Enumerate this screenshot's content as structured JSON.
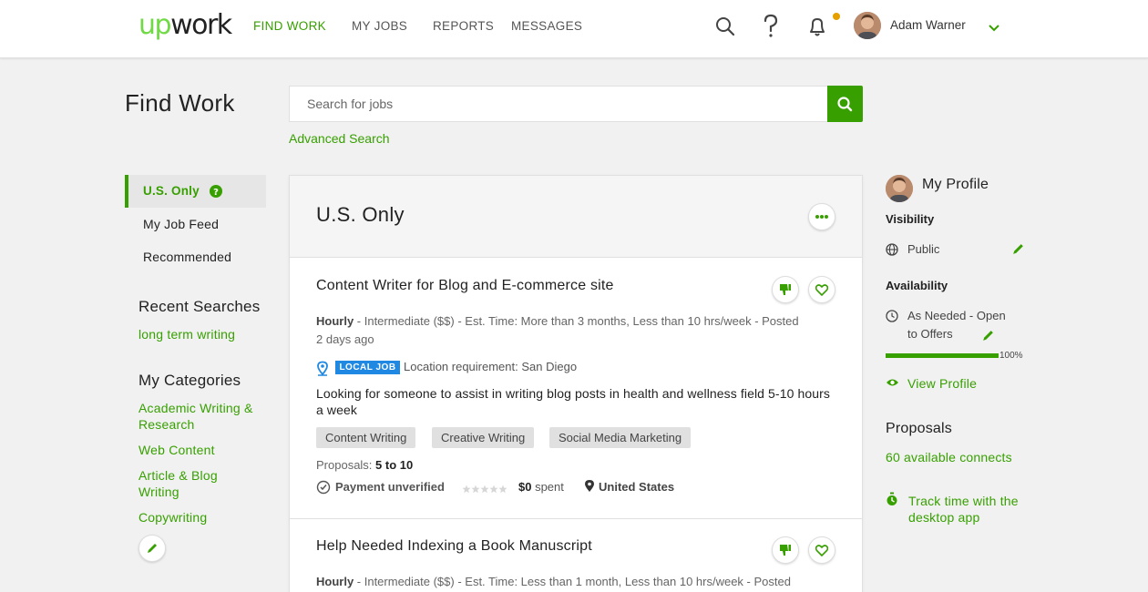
{
  "header": {
    "logo_up": "up",
    "logo_work": "work",
    "nav": [
      "FIND WORK",
      "MY JOBS",
      "REPORTS",
      "MESSAGES"
    ],
    "user_name": "Adam Warner",
    "notification_dot_color": "#e5a000"
  },
  "page": {
    "title": "Find Work",
    "search_placeholder": "Search for jobs",
    "advanced_search": "Advanced Search"
  },
  "sidebar": {
    "feeds": [
      "U.S. Only",
      "My Job Feed",
      "Recommended"
    ],
    "recent_searches_heading": "Recent Searches",
    "recent_searches": [
      "long term writing"
    ],
    "categories_heading": "My Categories",
    "categories": [
      "Academic Writing & Research",
      "Web Content",
      "Article & Blog Writing",
      "Copywriting"
    ]
  },
  "feed": {
    "title": "U.S. Only",
    "jobs": [
      {
        "title": "Content Writer for Blog and E-commerce site",
        "type": "Hourly",
        "meta": " - Intermediate ($$) - Est. Time: More than 3 months, Less than 10 hrs/week - Posted 2 days ago",
        "local_badge": "LOCAL JOB",
        "location_requirement": "Location requirement: San Diego",
        "description": "Looking for someone to assist in writing blog posts in health and wellness field 5-10 hours a week",
        "tags": [
          "Content Writing",
          "Creative Writing",
          "Social Media Marketing"
        ],
        "proposals_label": "Proposals: ",
        "proposals_value": "5 to 10",
        "payment": "Payment unverified",
        "spent_value": "$0",
        "spent_label": " spent",
        "country": "United States"
      },
      {
        "title": "Help Needed Indexing a Book Manuscript",
        "type": "Hourly",
        "meta": " - Intermediate ($$) - Est. Time: Less than 1 month, Less than 10 hrs/week - Posted"
      }
    ]
  },
  "profile": {
    "title": "My Profile",
    "visibility_label": "Visibility",
    "visibility_value": "Public",
    "availability_label": "Availability",
    "availability_value": "As Needed - Open to Offers",
    "completeness": 100,
    "completeness_label": "100%",
    "view_profile": "View Profile",
    "proposals_title": "Proposals",
    "connects": "60 available connects",
    "track_time": "Track time with the desktop app"
  },
  "colors": {
    "brand_green": "#37a000",
    "logo_green": "#6fda44",
    "local_job_blue": "#1f88e3"
  },
  "icons": [
    "search-icon",
    "help-icon",
    "bell-icon",
    "chevron-down-icon",
    "question-badge-icon",
    "pencil-icon",
    "more-icon",
    "thumbs-down-icon",
    "heart-icon",
    "location-pin-icon",
    "check-circle-icon",
    "star-icon",
    "globe-icon",
    "clock-icon",
    "eye-icon",
    "stopwatch-icon"
  ]
}
